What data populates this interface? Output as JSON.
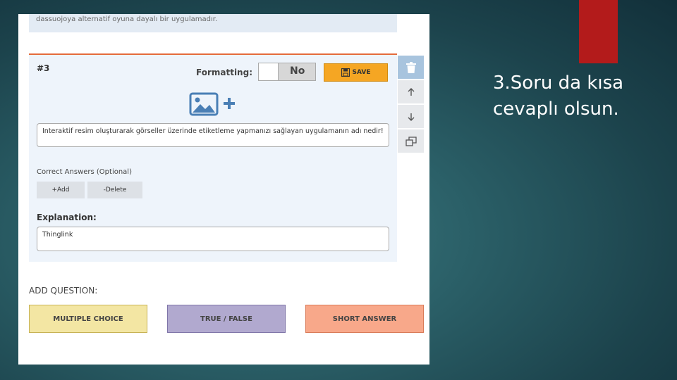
{
  "top_strip": {
    "text": "dassuojoya alternatif oyuna dayalı bir uygulamadır."
  },
  "question": {
    "number": "#3",
    "formatting_label": "Formatting:",
    "toggle_value": "No",
    "save_label": "SAVE",
    "text": "Interaktif resim oluşturarak görseller üzerinde etiketleme yapmanızı sağlayan uygulamanın adı nedir!",
    "correct_answers_label": "Correct Answers (Optional)",
    "add_label": "+Add",
    "delete_label": "-Delete",
    "explanation_label": "Explanation:",
    "explanation_value": "Thinglink"
  },
  "add_question": {
    "label": "ADD QUESTION:",
    "types": [
      {
        "label": "MULTIPLE CHOICE",
        "color": "#f3e6a3",
        "border": "#c7b254"
      },
      {
        "label": "TRUE / FALSE",
        "color": "#b1a9cf",
        "border": "#7f75a8"
      },
      {
        "label": "SHORT ANSWER",
        "color": "#f8a88a",
        "border": "#d97a57"
      }
    ]
  },
  "side_actions": [
    "trash-icon",
    "arrow-up-icon",
    "arrow-down-icon",
    "copy-icon"
  ],
  "slide": {
    "text": "3.Soru da kısa cevaplı olsun."
  },
  "colors": {
    "accent": "#b31b1b",
    "card_border": "#e46a3c",
    "save_button": "#f5a623",
    "icon_blue": "#4a7fb5"
  }
}
